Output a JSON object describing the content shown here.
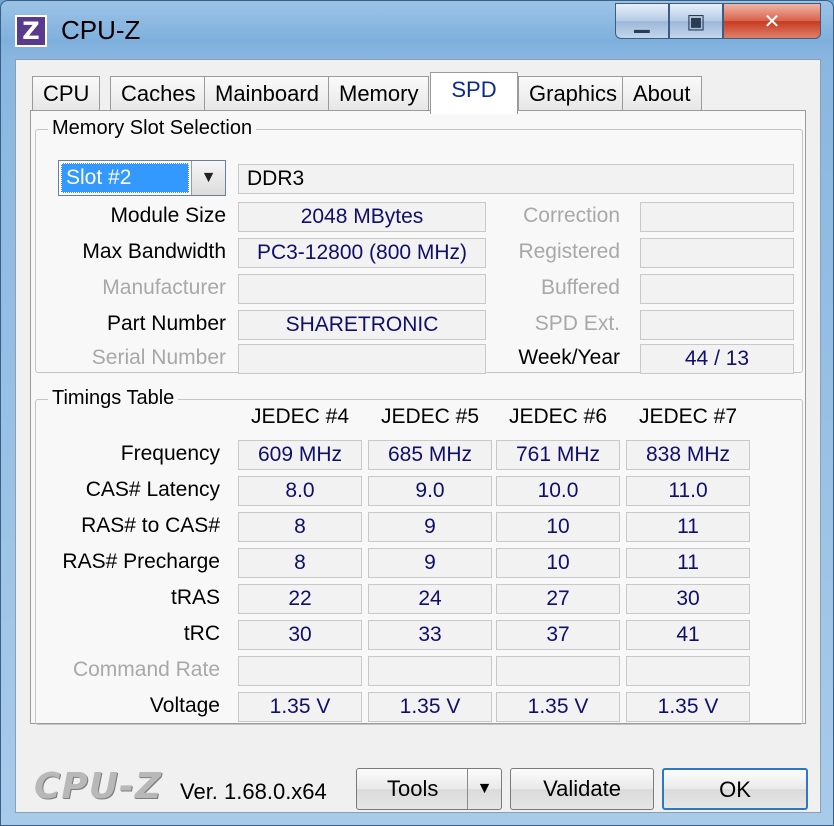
{
  "window": {
    "title": "CPU-Z",
    "icon_letter": "Z",
    "minimize": "▁",
    "maximize": "▣",
    "close": "✕"
  },
  "tabs": [
    {
      "label": "CPU"
    },
    {
      "label": "Caches"
    },
    {
      "label": "Mainboard"
    },
    {
      "label": "Memory"
    },
    {
      "label": "SPD",
      "active": true
    },
    {
      "label": "Graphics"
    },
    {
      "label": "About"
    }
  ],
  "slot_section": {
    "title": "Memory Slot Selection",
    "selected_slot": "Slot #2",
    "memory_type": "DDR3",
    "labels": {
      "module_size": "Module Size",
      "max_bandwidth": "Max Bandwidth",
      "manufacturer": "Manufacturer",
      "part_number": "Part Number",
      "serial_number": "Serial Number",
      "correction": "Correction",
      "registered": "Registered",
      "buffered": "Buffered",
      "spd_ext": "SPD Ext.",
      "week_year": "Week/Year"
    },
    "values": {
      "module_size": "2048 MBytes",
      "max_bandwidth": "PC3-12800 (800 MHz)",
      "manufacturer": "",
      "part_number": "SHARETRONIC",
      "serial_number": "",
      "correction": "",
      "registered": "",
      "buffered": "",
      "spd_ext": "",
      "week_year": "44 / 13"
    }
  },
  "timings": {
    "title": "Timings Table",
    "columns": [
      "JEDEC #4",
      "JEDEC #5",
      "JEDEC #6",
      "JEDEC #7"
    ],
    "rows": [
      {
        "label": "Frequency",
        "dim": false,
        "values": [
          "609 MHz",
          "685 MHz",
          "761 MHz",
          "838 MHz"
        ]
      },
      {
        "label": "CAS# Latency",
        "dim": false,
        "values": [
          "8.0",
          "9.0",
          "10.0",
          "11.0"
        ]
      },
      {
        "label": "RAS# to CAS#",
        "dim": false,
        "values": [
          "8",
          "9",
          "10",
          "11"
        ]
      },
      {
        "label": "RAS# Precharge",
        "dim": false,
        "values": [
          "8",
          "9",
          "10",
          "11"
        ]
      },
      {
        "label": "tRAS",
        "dim": false,
        "values": [
          "22",
          "24",
          "27",
          "30"
        ]
      },
      {
        "label": "tRC",
        "dim": false,
        "values": [
          "30",
          "33",
          "37",
          "41"
        ]
      },
      {
        "label": "Command Rate",
        "dim": true,
        "values": [
          "",
          "",
          "",
          ""
        ]
      },
      {
        "label": "Voltage",
        "dim": false,
        "values": [
          "1.35 V",
          "1.35 V",
          "1.35 V",
          "1.35 V"
        ]
      }
    ]
  },
  "footer": {
    "logo": "CPU-Z",
    "version": "Ver. 1.68.0.x64",
    "tools_label": "Tools",
    "validate_label": "Validate",
    "ok_label": "OK"
  }
}
